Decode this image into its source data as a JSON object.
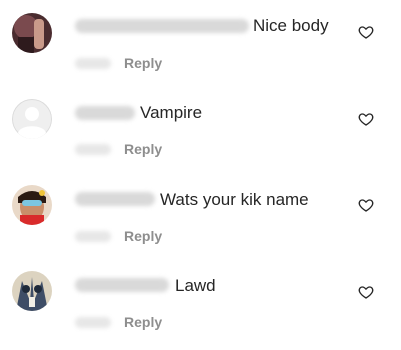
{
  "comments": [
    {
      "text": "Nice body",
      "reply_label": "Reply",
      "avatar_icon": "user-photo-avatar-icon",
      "like_icon": "heart-outline-icon"
    },
    {
      "text": "Vampire",
      "reply_label": "Reply",
      "avatar_icon": "default-avatar-icon",
      "like_icon": "heart-outline-icon"
    },
    {
      "text": "Wats your kik name",
      "reply_label": "Reply",
      "avatar_icon": "user-photo-avatar-icon",
      "like_icon": "heart-outline-icon"
    },
    {
      "text": "Lawd",
      "reply_label": "Reply",
      "avatar_icon": "user-photo-avatar-icon",
      "like_icon": "heart-outline-icon"
    }
  ],
  "colors": {
    "text": "#262626",
    "secondary_text": "#8e8e8e",
    "background": "#ffffff"
  }
}
